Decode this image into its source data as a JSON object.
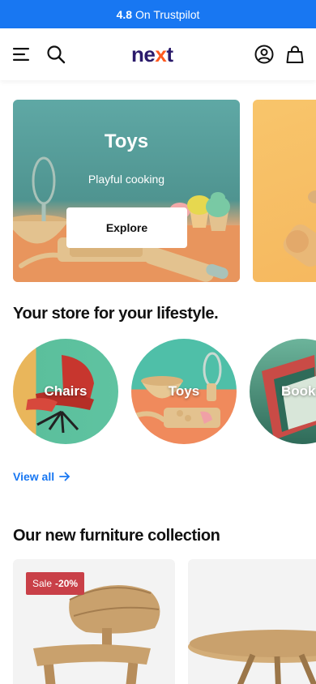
{
  "trustbar": {
    "rating": "4.8",
    "text": "On Trustpilot"
  },
  "header": {
    "logo": {
      "n": "n",
      "e": "e",
      "x": "x",
      "t": "t"
    }
  },
  "hero": [
    {
      "title": "Toys",
      "subtitle": "Playful cooking",
      "button": "Explore"
    }
  ],
  "lifestyle": {
    "title": "Your store for your lifestyle.",
    "categories": [
      {
        "label": "Chairs"
      },
      {
        "label": "Toys"
      },
      {
        "label": "Books"
      }
    ],
    "view_all": "View all"
  },
  "collection": {
    "title": "Our new furniture collection",
    "products": [
      {
        "badge_prefix": "Sale",
        "badge_value": "-20%"
      }
    ]
  },
  "colors": {
    "trustbar_bg": "#1877f2",
    "link": "#1877f2",
    "sale_badge": "#c94048",
    "logo_dark": "#2b1b6b",
    "logo_accent": "#ff5a1f"
  }
}
